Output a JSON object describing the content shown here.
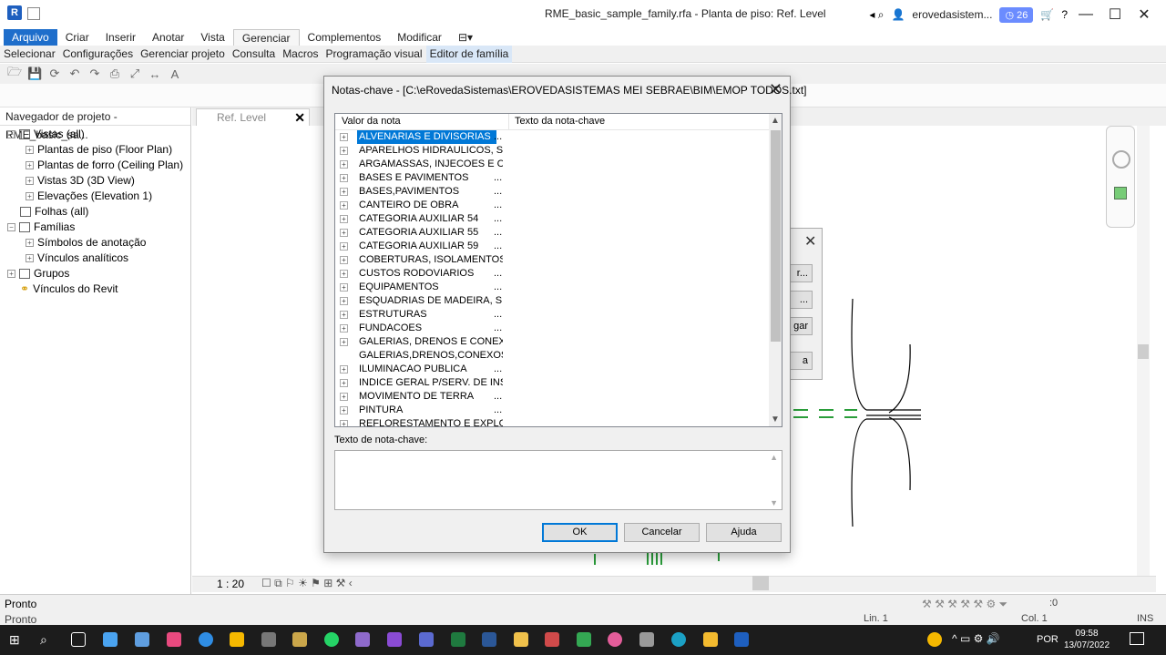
{
  "window": {
    "title": "RME_basic_sample_family.rfa - Planta de piso: Ref. Level",
    "logo": "R",
    "user": "erovedasistem...",
    "badge": "26"
  },
  "ribbon": {
    "tabs": [
      "Arquivo",
      "Criar",
      "Inserir",
      "Anotar",
      "Vista",
      "Gerenciar",
      "Complementos",
      "Modificar"
    ],
    "subtabs": [
      "Selecionar",
      "Configurações",
      "Gerenciar projeto",
      "Consulta",
      "Macros",
      "Programação visual",
      "Editor de família"
    ]
  },
  "navigator": {
    "title": "Navegador de projeto - RME_basic_sa...",
    "items": [
      {
        "label": "Vistas (all)",
        "level": 0
      },
      {
        "label": "Plantas de piso (Floor Plan)",
        "level": 1
      },
      {
        "label": "Plantas de forro (Ceiling Plan)",
        "level": 1
      },
      {
        "label": "Vistas 3D (3D View)",
        "level": 1
      },
      {
        "label": "Elevações (Elevation 1)",
        "level": 1
      },
      {
        "label": "Folhas (all)",
        "level": 0
      },
      {
        "label": "Famílias",
        "level": 0
      },
      {
        "label": "Símbolos de anotação",
        "level": 1
      },
      {
        "label": "Vínculos analíticos",
        "level": 1
      },
      {
        "label": "Grupos",
        "level": 0
      },
      {
        "label": "Vínculos do Revit",
        "level": 0
      }
    ]
  },
  "view": {
    "tab_label": "Ref. Level",
    "scale": "1 : 20"
  },
  "dialog": {
    "title": "Notas-chave - [C:\\eRovedaSistemas\\EROVEDASISTEMAS MEI SEBRAE\\BIM\\EMOP TODOS.txt]",
    "col_value": "Valor da nota",
    "col_text": "Texto da nota-chave",
    "rows": [
      {
        "label": "ALVENARIAS E DIVISORIAS",
        "dots": "...",
        "selected": true,
        "expand": true
      },
      {
        "label": "APARELHOS HIDRAULICOS, SA...",
        "dots": "",
        "expand": true
      },
      {
        "label": "ARGAMASSAS, INJECOES E CO...",
        "dots": "",
        "expand": true
      },
      {
        "label": "BASES E PAVIMENTOS",
        "dots": "...",
        "expand": true
      },
      {
        "label": "BASES,PAVIMENTOS",
        "dots": "...",
        "expand": true
      },
      {
        "label": "CANTEIRO DE OBRA",
        "dots": "...",
        "expand": true
      },
      {
        "label": "CATEGORIA AUXILIAR 54",
        "dots": "...",
        "expand": true
      },
      {
        "label": "CATEGORIA AUXILIAR 55",
        "dots": "...",
        "expand": true
      },
      {
        "label": "CATEGORIA AUXILIAR 59",
        "dots": "...",
        "expand": true
      },
      {
        "label": "COBERTURAS, ISOLAMENTOS ...",
        "dots": "",
        "expand": true
      },
      {
        "label": "CUSTOS RODOVIARIOS",
        "dots": "...",
        "expand": true
      },
      {
        "label": "EQUIPAMENTOS",
        "dots": "...",
        "expand": true
      },
      {
        "label": "ESQUADRIAS DE MADEIRA, SE...",
        "dots": "",
        "expand": true
      },
      {
        "label": "ESTRUTURAS",
        "dots": "...",
        "expand": true
      },
      {
        "label": "FUNDACOES",
        "dots": "...",
        "expand": true
      },
      {
        "label": "GALERIAS, DRENOS E CONEX...",
        "dots": "",
        "expand": true
      },
      {
        "label": "GALERIAS,DRENOS,CONEXOS ...",
        "dots": "",
        "expand": false
      },
      {
        "label": "ILUMINACAO PUBLICA",
        "dots": "...",
        "expand": true
      },
      {
        "label": "INDICE GERAL P/SERV. DE INS...",
        "dots": "",
        "expand": true
      },
      {
        "label": "MOVIMENTO DE TERRA",
        "dots": "...",
        "expand": true
      },
      {
        "label": "PINTURA",
        "dots": "...",
        "expand": true
      },
      {
        "label": "REFLORESTAMENTO E EXPLO...",
        "dots": "",
        "expand": true
      }
    ],
    "text_label": "Texto de nota-chave:",
    "ok": "OK",
    "cancel": "Cancelar",
    "help": "Ajuda"
  },
  "stub_dialog": {
    "buttons": [
      "r...",
      "...",
      "gar",
      "a"
    ]
  },
  "status": {
    "main": "Pronto",
    "secondary": "Pronto",
    "lin": "Lin. 1",
    "col": "Col. 1",
    "ins": "INS",
    "filter": ":0"
  },
  "taskbar": {
    "lang": "POR",
    "time": "09:58",
    "date": "13/07/2022"
  },
  "colors": {
    "accent": "#1e6ecb",
    "selection": "#0078d7"
  }
}
